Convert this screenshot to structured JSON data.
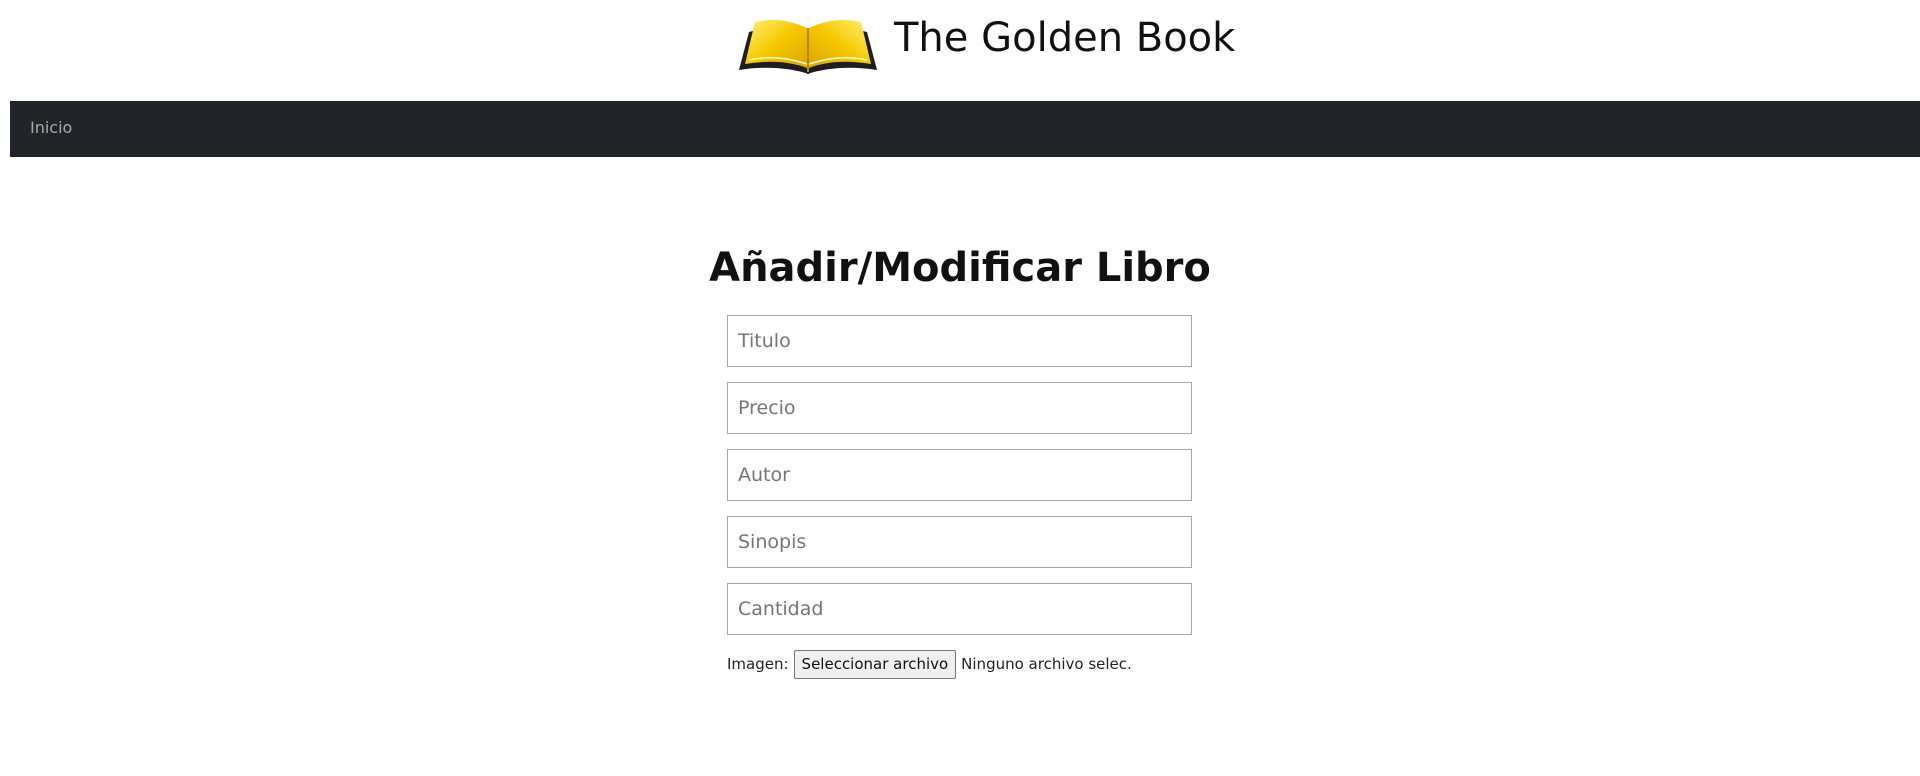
{
  "header": {
    "site_title": "The Golden Book",
    "logo_icon": "open-book-icon"
  },
  "nav": {
    "items": [
      {
        "label": "Inicio"
      }
    ]
  },
  "form": {
    "title": "Añadir/Modificar Libro",
    "fields": [
      {
        "name": "titulo",
        "placeholder": "Titulo",
        "value": ""
      },
      {
        "name": "precio",
        "placeholder": "Precio",
        "value": ""
      },
      {
        "name": "autor",
        "placeholder": "Autor",
        "value": ""
      },
      {
        "name": "sinopis",
        "placeholder": "Sinopis",
        "value": ""
      },
      {
        "name": "cantidad",
        "placeholder": "Cantidad",
        "value": ""
      }
    ],
    "image": {
      "label": "Imagen:",
      "button_label": "Seleccionar archivo",
      "status": "Ninguno archivo selec."
    }
  },
  "colors": {
    "navbar_bg": "#212529",
    "logo_gold": "#f2c200"
  }
}
